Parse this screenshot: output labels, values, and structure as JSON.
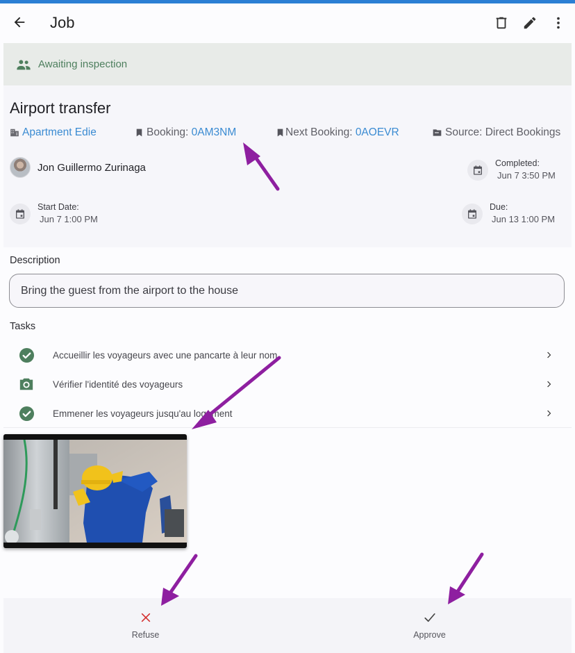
{
  "appbar": {
    "title": "Job",
    "icons": {
      "back": "arrow-left-icon",
      "delete": "trash-icon",
      "edit": "pencil-icon",
      "more": "more-vertical-icon"
    }
  },
  "status": {
    "label": "Awaiting inspection",
    "icon": "people-icon",
    "color": "#4e7f5e"
  },
  "job": {
    "title": "Airport transfer",
    "property": {
      "label": "Apartment Edie",
      "icon": "building-icon"
    },
    "booking": {
      "label": "Booking: ",
      "value": "0AM3NM",
      "icon": "bookmark-icon"
    },
    "next_booking": {
      "label": "Next Booking: ",
      "value": "0AOEVR",
      "icon": "bookmark-icon"
    },
    "source": {
      "label": "Source: Direct Bookings",
      "icon": "folder-icon"
    },
    "assignee": {
      "name": "Jon Guillermo Zurinaga"
    },
    "completed": {
      "label": "Completed:",
      "value": "Jun 7 3:50 PM"
    },
    "start_date": {
      "label": "Start Date:",
      "value": "Jun 7 1:00 PM"
    },
    "due": {
      "label": "Due:",
      "value": "Jun 13 1:00 PM"
    }
  },
  "description": {
    "label": "Description",
    "value": "Bring the guest from the airport to the house"
  },
  "tasks": {
    "label": "Tasks",
    "items": [
      {
        "label": "Accueillir les voyageurs avec une pancarte à leur nom",
        "icon": "check-circle-icon",
        "status": "done"
      },
      {
        "label": "Vérifier l'identité des voyageurs",
        "icon": "camera-icon",
        "status": "photo"
      },
      {
        "label": "Emmener les voyageurs jusqu'au logement",
        "icon": "check-circle-icon",
        "status": "done"
      }
    ]
  },
  "photo": {
    "alt": "Worker in yellow hard hat and blue overalls inspecting machinery"
  },
  "actions": {
    "refuse": {
      "label": "Refuse",
      "icon": "close-icon",
      "color": "#d32f2f"
    },
    "approve": {
      "label": "Approve",
      "icon": "check-icon",
      "color": "#444444"
    }
  },
  "colors": {
    "accent": "#2b7fd4",
    "link": "#3a8bd2",
    "success": "#4e7f5e",
    "annotation": "#8e1fa0"
  }
}
